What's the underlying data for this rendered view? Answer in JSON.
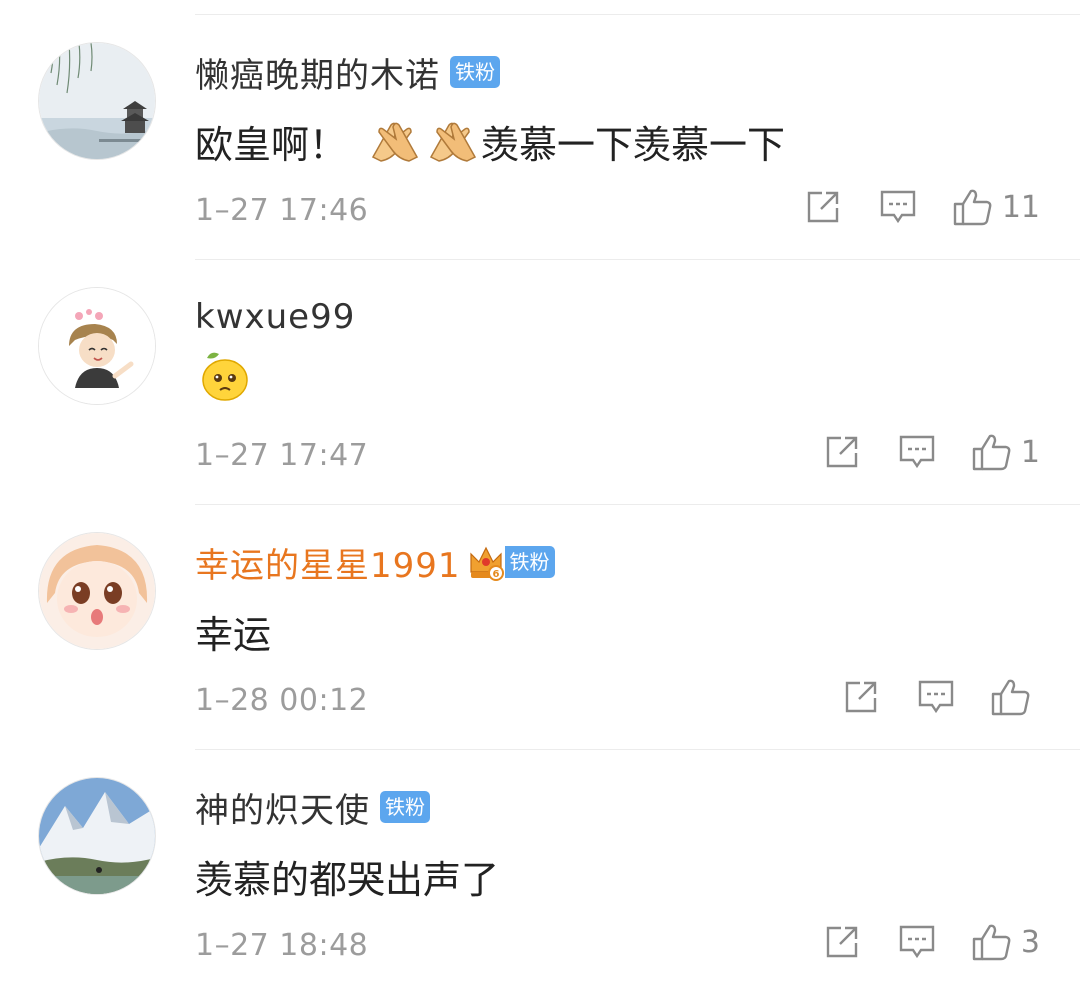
{
  "comments": [
    {
      "username": "懒癌晚期的木诺",
      "badge": "铁粉",
      "text_before": "欧皇啊！",
      "emoji": "clap-hands-icon",
      "text_after": "羡慕一下羡慕一下",
      "time": "1–27 17:46",
      "likes": "11"
    },
    {
      "username": "kwxue99",
      "emoji": "sad-lemon-icon",
      "time": "1–27 17:47",
      "likes": "1"
    },
    {
      "username": "幸运的星星1991",
      "badge": "铁粉",
      "badge_icon": "crown-icon",
      "text": "幸运",
      "time": "1–28 00:12",
      "likes": ""
    },
    {
      "username": "神的炽天使",
      "badge": "铁粉",
      "text": "羡慕的都哭出声了",
      "time": "1–27 18:48",
      "likes": "3"
    }
  ],
  "icons": {
    "share": "share-icon",
    "reply": "comment-icon",
    "like": "thumbs-up-icon"
  },
  "colors": {
    "username": "#333333",
    "vip_username": "#e8761f",
    "badge_bg": "#5ca6ee",
    "meta": "#9c9c9c"
  }
}
